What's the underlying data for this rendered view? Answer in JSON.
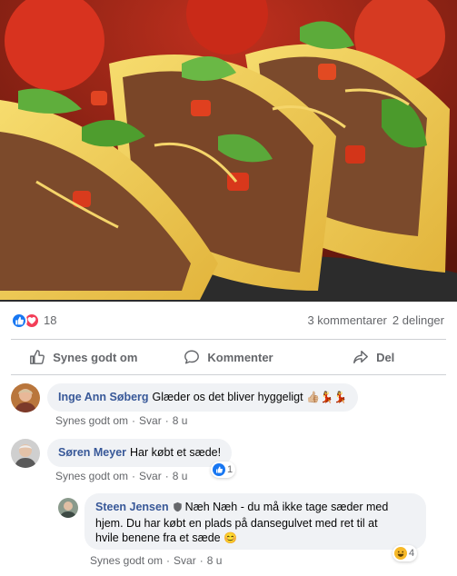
{
  "post": {
    "image_alt": "Tacos med oksekød, salat, tomat og ost",
    "reaction_count": "18",
    "comments_count": "3 kommentarer",
    "shares_count": "2 delinger"
  },
  "actions": {
    "like": "Synes godt om",
    "comment": "Kommenter",
    "share": "Del"
  },
  "comments": [
    {
      "author": "Inge Ann Søberg",
      "text": "Glæder os det bliver hyggeligt",
      "emojis": "👍🏼💃💃",
      "like_link": "Synes godt om",
      "reply_link": "Svar",
      "time": "8 u"
    },
    {
      "author": "Søren Meyer",
      "text": "Har købt et sæde!",
      "like_link": "Synes godt om",
      "reply_link": "Svar",
      "time": "8 u",
      "reactions": "1"
    }
  ],
  "reply": {
    "author": "Steen Jensen",
    "line1": "Næh Næh - du må ikke tage sæder med",
    "line2": "hjem. Du har købt en plads på dansegulvet med ret til at",
    "line3": "hvile benene fra et sæde",
    "emoji": "😊",
    "like_link": "Synes godt om",
    "reply_link": "Svar",
    "time": "8 u",
    "reactions": "4"
  },
  "colors": {
    "link": "#385898",
    "like_blue": "#1877f2",
    "love_red": "#f33e58",
    "haha_yellow": "#f7b928",
    "muted": "#65676b",
    "bubble": "#f0f2f5"
  }
}
